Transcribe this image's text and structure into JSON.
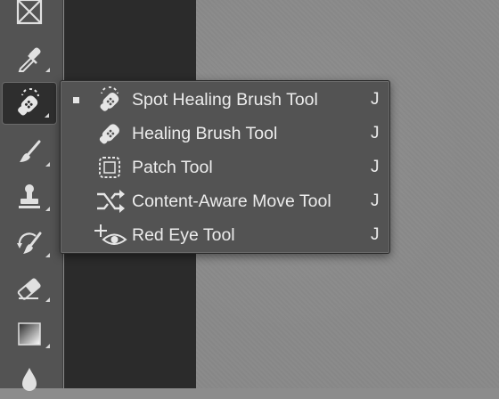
{
  "toolbar": {
    "tools": [
      {
        "name": "Frame Tool",
        "icon": "frame-icon",
        "has_submenu": false
      },
      {
        "name": "Eyedropper Tool",
        "icon": "eyedropper-icon",
        "has_submenu": true
      },
      {
        "name": "Spot Healing Brush Tool",
        "icon": "spot-healing-brush-icon",
        "has_submenu": true,
        "active": true
      },
      {
        "name": "Brush Tool",
        "icon": "brush-icon",
        "has_submenu": true
      },
      {
        "name": "Clone Stamp Tool",
        "icon": "clone-stamp-icon",
        "has_submenu": true
      },
      {
        "name": "History Brush Tool",
        "icon": "history-brush-icon",
        "has_submenu": true
      },
      {
        "name": "Eraser Tool",
        "icon": "eraser-icon",
        "has_submenu": true
      },
      {
        "name": "Gradient Tool",
        "icon": "gradient-icon",
        "has_submenu": true
      },
      {
        "name": "Blur Tool",
        "icon": "blur-drop-icon",
        "has_submenu": false
      }
    ]
  },
  "flyout": {
    "items": [
      {
        "label": "Spot Healing Brush Tool",
        "shortcut": "J",
        "icon": "spot-healing-brush-icon",
        "selected": true
      },
      {
        "label": "Healing Brush Tool",
        "shortcut": "J",
        "icon": "healing-brush-icon",
        "selected": false
      },
      {
        "label": "Patch Tool",
        "shortcut": "J",
        "icon": "patch-icon",
        "selected": false
      },
      {
        "label": "Content-Aware Move Tool",
        "shortcut": "J",
        "icon": "content-aware-move-icon",
        "selected": false
      },
      {
        "label": "Red Eye Tool",
        "shortcut": "J",
        "icon": "red-eye-icon",
        "selected": false
      }
    ]
  },
  "colors": {
    "toolbar_bg": "#535353",
    "pasteboard": "#2b2b2b",
    "canvas": "#898989",
    "text": "#ececec"
  }
}
